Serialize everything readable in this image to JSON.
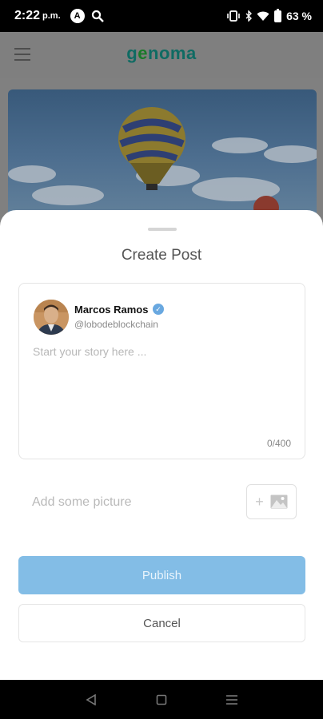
{
  "status_bar": {
    "time": "2:22",
    "ampm": "p.m.",
    "battery": "63 %"
  },
  "app": {
    "logo_prefix": "g",
    "logo_o": "e",
    "logo_suffix": "noma"
  },
  "sheet": {
    "title": "Create Post",
    "user": {
      "name": "Marcos Ramos",
      "handle": "@lobodeblockchain"
    },
    "story_placeholder": "Start your story here ...",
    "char_count": "0/400",
    "add_picture_label": "Add some picture",
    "publish_label": "Publish",
    "cancel_label": "Cancel"
  },
  "colors": {
    "publish": "#83bde6",
    "verified": "#69a8e0",
    "logo": "#0f6b63"
  }
}
